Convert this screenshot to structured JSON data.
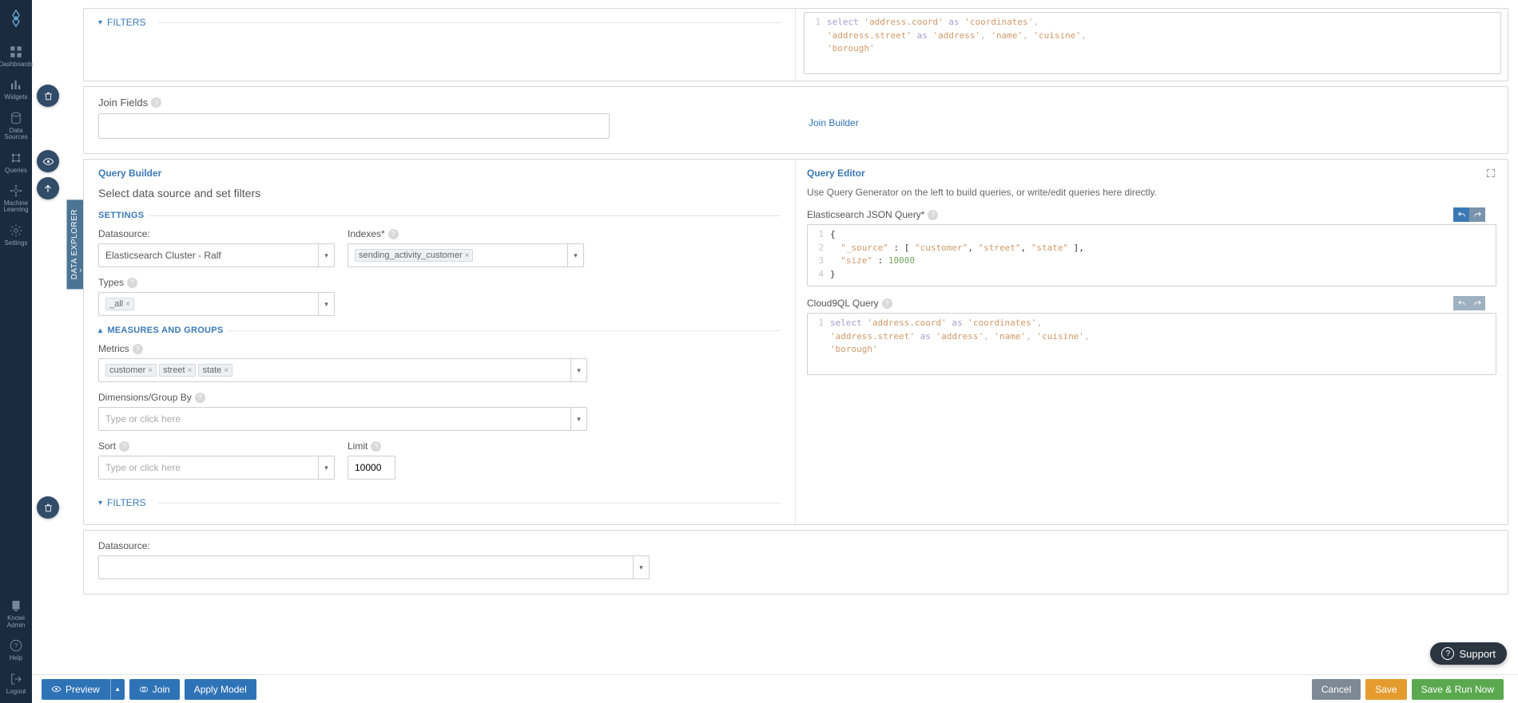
{
  "nav": {
    "dashboards": "Dashboards",
    "widgets": "Widgets",
    "data_sources": "Data Sources",
    "queries": "Queries",
    "machine_learning": "Machine Learning",
    "settings": "Settings",
    "admin": "Knowi Admin",
    "help": "Help",
    "logout": "Logout"
  },
  "side_tab": "DATA EXPLORER",
  "filters_label": "FILTERS",
  "top_code": {
    "line1_a": "select ",
    "line1_b": "'address.coord'",
    "line1_c": " as ",
    "line1_d": "'coordinates'",
    "line1_e": ",",
    "line2_a": "'address.street'",
    "line2_b": " as ",
    "line2_c": "'address'",
    "line2_d": ", ",
    "line2_e": "'name'",
    "line2_f": ", ",
    "line2_g": "'cuisine'",
    "line2_h": ",",
    "line3": "'borough'",
    "ln1": "1"
  },
  "join": {
    "label": "Join Fields",
    "builder_link": "Join Builder"
  },
  "qb": {
    "title": "Query Builder",
    "subtitle": "Select data source and set filters",
    "settings": "SETTINGS",
    "datasource_label": "Datasource:",
    "datasource_value": "Elasticsearch Cluster - Ralf",
    "indexes_label": "Indexes*",
    "indexes_tag": "sending_activity_customer",
    "types_label": "Types",
    "types_value": "_all",
    "measures": "MEASURES AND GROUPS",
    "metrics_label": "Metrics",
    "metrics_tags": [
      "customer",
      "street",
      "state"
    ],
    "dimensions_label": "Dimensions/Group By",
    "dimensions_placeholder": "Type or click here",
    "sort_label": "Sort",
    "sort_placeholder": "Type or click here",
    "limit_label": "Limit",
    "limit_value": "10000",
    "filters": "FILTERS"
  },
  "qe": {
    "title": "Query Editor",
    "subtitle": "Use Query Generator on the left to build queries, or write/edit queries here directly.",
    "es_label": "Elasticsearch JSON Query*",
    "es": {
      "l1": "{",
      "l2_a": "\"_source\"",
      "l2_b": " : [ ",
      "l2_c": "\"customer\"",
      "l2_d": ", ",
      "l2_e": "\"street\"",
      "l2_f": ", ",
      "l2_g": "\"state\"",
      "l2_h": " ],",
      "l3_a": "\"size\"",
      "l3_b": " : ",
      "l3_c": "10000",
      "l4": "}",
      "ln1": "1",
      "ln2": "2",
      "ln3": "3",
      "ln4": "4"
    },
    "c9_label": "Cloud9QL Query",
    "c9_ln1": "1"
  },
  "add_ds_label": "Datasource:",
  "footer": {
    "preview": "Preview",
    "join": "Join",
    "apply_model": "Apply Model",
    "cancel": "Cancel",
    "save": "Save",
    "save_run": "Save & Run Now"
  },
  "support": "Support"
}
